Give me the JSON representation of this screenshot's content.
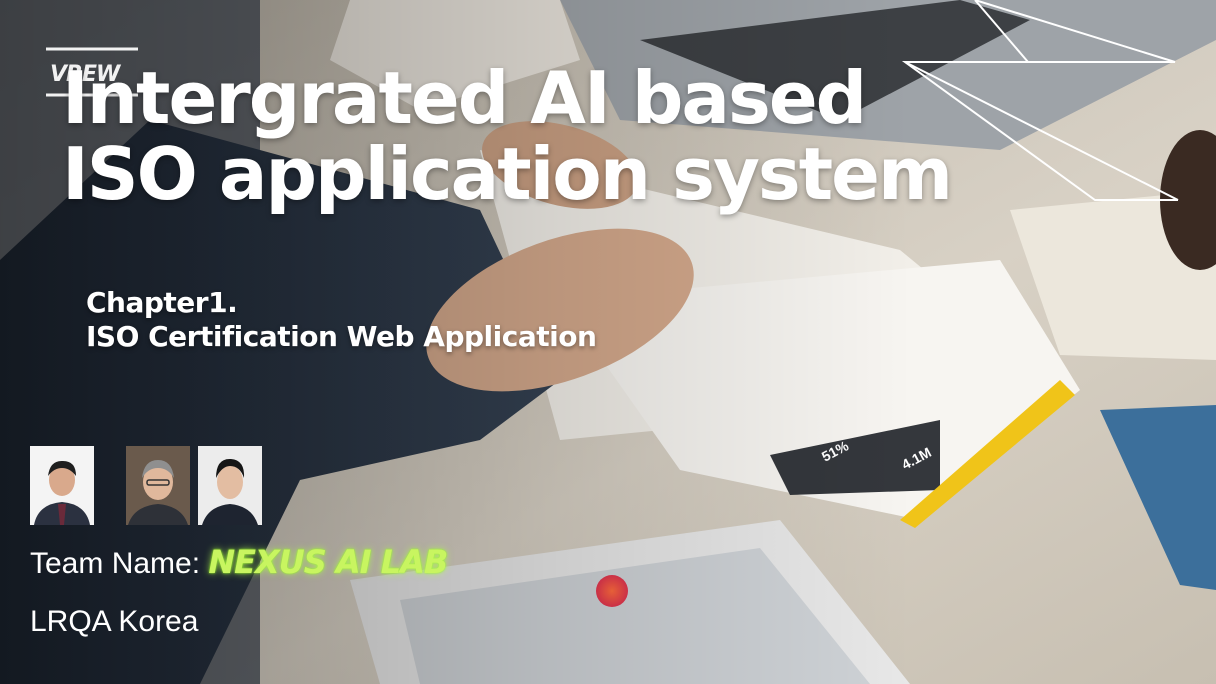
{
  "watermark": "VREW",
  "title": {
    "line1": "Intergrated AI based",
    "line2": "ISO application system"
  },
  "subtitle": {
    "line1": "Chapter1.",
    "line2": "ISO Certification Web Application"
  },
  "team": {
    "label": "Team Name: ",
    "name": "NEXUS AI LAB"
  },
  "organization": "LRQA Korea",
  "document_text": {
    "stat1": "4.1M",
    "stat2": "51%"
  },
  "colors": {
    "title": "#ffffff",
    "team_name_glow": "#c8f560",
    "doc_accent": "#f0c419"
  }
}
